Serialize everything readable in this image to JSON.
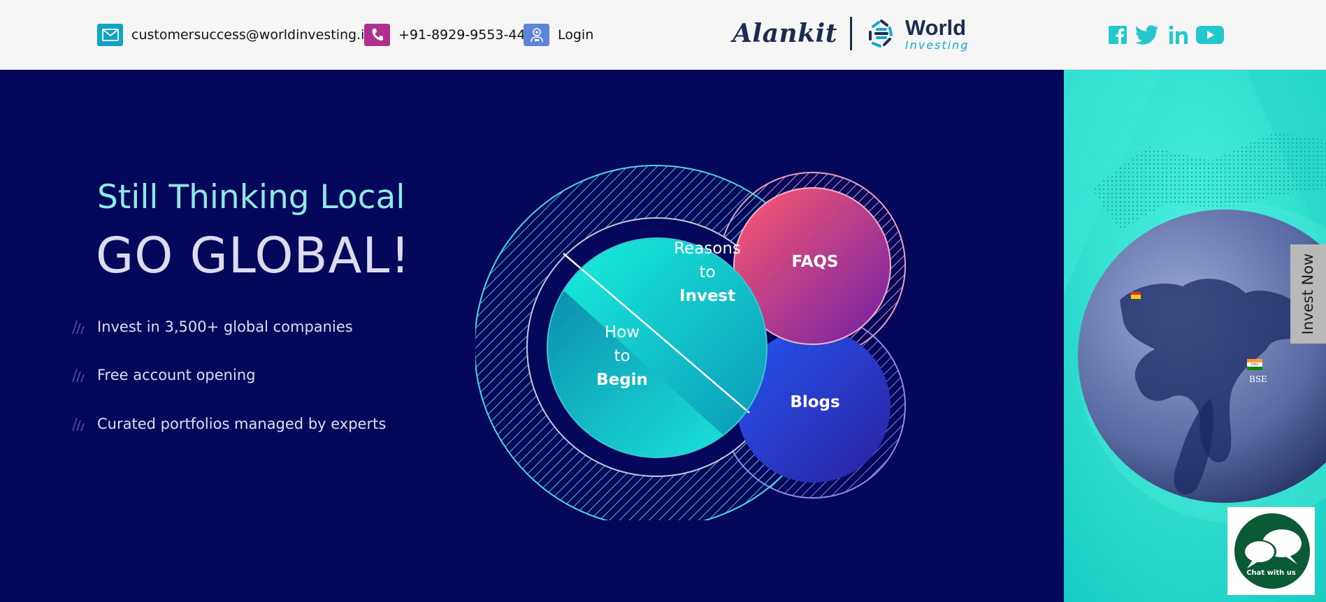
{
  "header": {
    "email": "customersuccess@worldinvesting.in",
    "phone": "+91-8929-9553-44",
    "login": "Login",
    "logo_alankit": "Alankit",
    "logo_world": "World",
    "logo_investing": "Investing"
  },
  "social": [
    "facebook-icon",
    "twitter-icon",
    "linkedin-icon",
    "youtube-icon"
  ],
  "hero": {
    "tagline": "Still Thinking Local",
    "headline": "GO GLOBAL!",
    "features": [
      "Invest in 3,500+ global companies",
      "Free account opening",
      "Curated portfolios managed by experts"
    ]
  },
  "venn": {
    "reasons_1": "Reasons",
    "reasons_2": "to",
    "reasons_3": "Invest",
    "how_1": "How",
    "how_2": "to",
    "how_3": "Begin",
    "faqs": "FAQS",
    "blogs": "Blogs"
  },
  "globe": {
    "marker_india": "India",
    "exchange_bse": "BSE"
  },
  "side_tab": "Invest Now",
  "chat": "Chat with us",
  "colors": {
    "background": "#04075a",
    "teal": "#2de0cc",
    "faqs_pink": "#f0496f",
    "blogs_blue": "#1f3fe0",
    "chat_green": "#0b5a36"
  }
}
